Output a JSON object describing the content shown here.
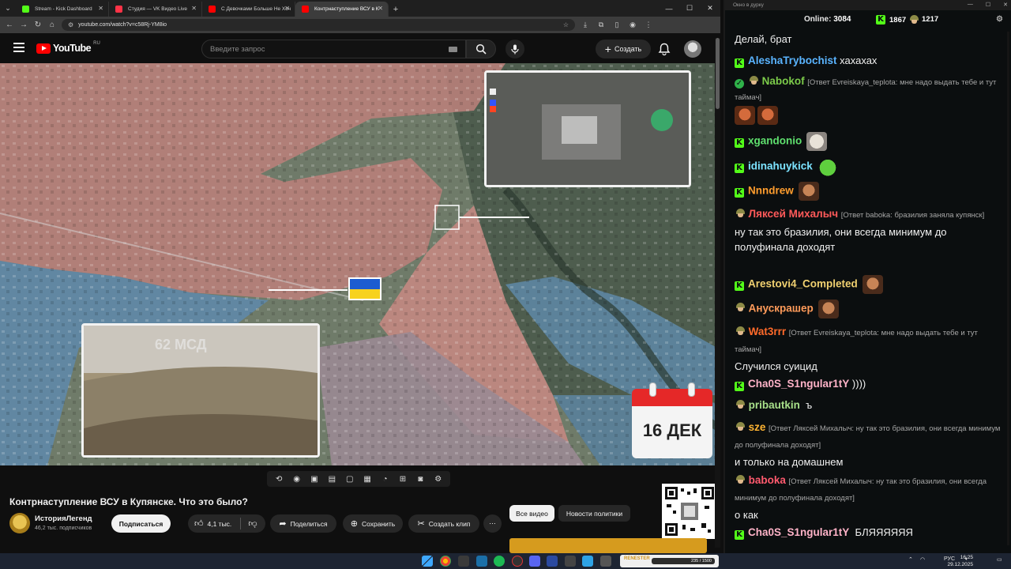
{
  "browser": {
    "tabs": [
      {
        "label": "Stream - Kick Dashboard",
        "icon": "kick-icon",
        "color": "#53fc18"
      },
      {
        "label": "Студия — VK Видео Live",
        "icon": "vk-video-icon",
        "color": "#ff3347"
      },
      {
        "label": "С Девочками Больше Не Хоч",
        "icon": "youtube-icon",
        "color": "#ff0000"
      },
      {
        "label": "Контрнаступление ВСУ в К",
        "icon": "youtube-icon",
        "color": "#ff0000"
      }
    ],
    "url": "youtube.com/watch?v=c58Rj-YM8io"
  },
  "youtube": {
    "logo_text": "YouTube",
    "region": "RU",
    "search_placeholder": "Введите запрос",
    "create_label": "Создать"
  },
  "video": {
    "calendar_date": "16 ДЕК",
    "title": "Контрнаступление ВСУ в Купянске. Что это было?",
    "channel_name": "ИсторияЛегенд",
    "subscribers": "46,2 тыс. подписчиков",
    "subscribe_label": "Подписаться",
    "likes": "4,1 тыс.",
    "share_label": "Поделиться",
    "save_label": "Сохранить",
    "clip_label": "Создать клип",
    "filters": [
      "Все видео",
      "Новости политики"
    ]
  },
  "chat": {
    "window_title": "Окно в дурку",
    "online_label": "Online:",
    "online_count": "3084",
    "kick_count": "1867",
    "helmet_count": "1217",
    "messages": [
      {
        "text": "Делай, брат"
      },
      {
        "user": "AleshaTrybochist",
        "color": "#5ab4ff",
        "text": "хахахах"
      },
      {
        "user": "Nabokof",
        "color": "#7ccb4a",
        "reply": "[Ответ Evreiskaya_teplota: мне надо выдать тебе и тут таймач]"
      },
      {
        "user": "xgandonio",
        "color": "#5fe06e",
        "text": ""
      },
      {
        "user": "idinahuykick",
        "color": "#7ce3ff",
        "text": ""
      },
      {
        "user": "Nnndrew",
        "color": "#ff9d2e",
        "text": ""
      },
      {
        "user": "Ляксей Михалыч",
        "color": "#ff5a5a",
        "reply": "[Ответ baboka: бразилия заняла купянск]",
        "text": "ну так  это бразилия, они всегда минимум до полуфинала доходят"
      },
      {
        "user": "Arestovi4_Completed",
        "color": "#f0d070",
        "text": ""
      },
      {
        "user": "Анускрашер",
        "color": "#ff9b5a",
        "text": ""
      },
      {
        "user": "Wat3rrr",
        "color": "#ff6a2a",
        "reply": "[Ответ Evreiskaya_teplota: мне надо выдать тебе и тут таймач]",
        "text": "Случился суицид"
      },
      {
        "user": "Cha0S_S1ngular1tY",
        "color": "#ffb3c8",
        "text": "))))"
      },
      {
        "user": "pribautkin",
        "color": "#a8e08a",
        "text": "ъ"
      },
      {
        "user": "sze",
        "color": "#ffb432",
        "reply": "[Ответ Ляксей Михалыч: ну так  это бразилия, они всегда минимум до полуфинала доходят]",
        "text": "и только на домашнем"
      },
      {
        "user": "baboka",
        "color": "#ff5a6e",
        "reply": "[Ответ Ляксей Михалыч: ну так  это бразилия, они всегда минимум до полуфинала доходят]",
        "text": "о как"
      },
      {
        "user": "Cha0S_S1ngular1tY",
        "color": "#ffb3c8",
        "text": "БЛЯЯЯЯЯЯ"
      }
    ]
  },
  "taskbar": {
    "widget_name": "RENESTER",
    "widget_progress_text": "235 / 1500",
    "widget_progress": 0.157,
    "lang": "РУС",
    "time": "16:25",
    "date": "29.12.2025"
  },
  "colors": {
    "kick_green": "#53fc18",
    "youtube_red": "#ff0000"
  }
}
